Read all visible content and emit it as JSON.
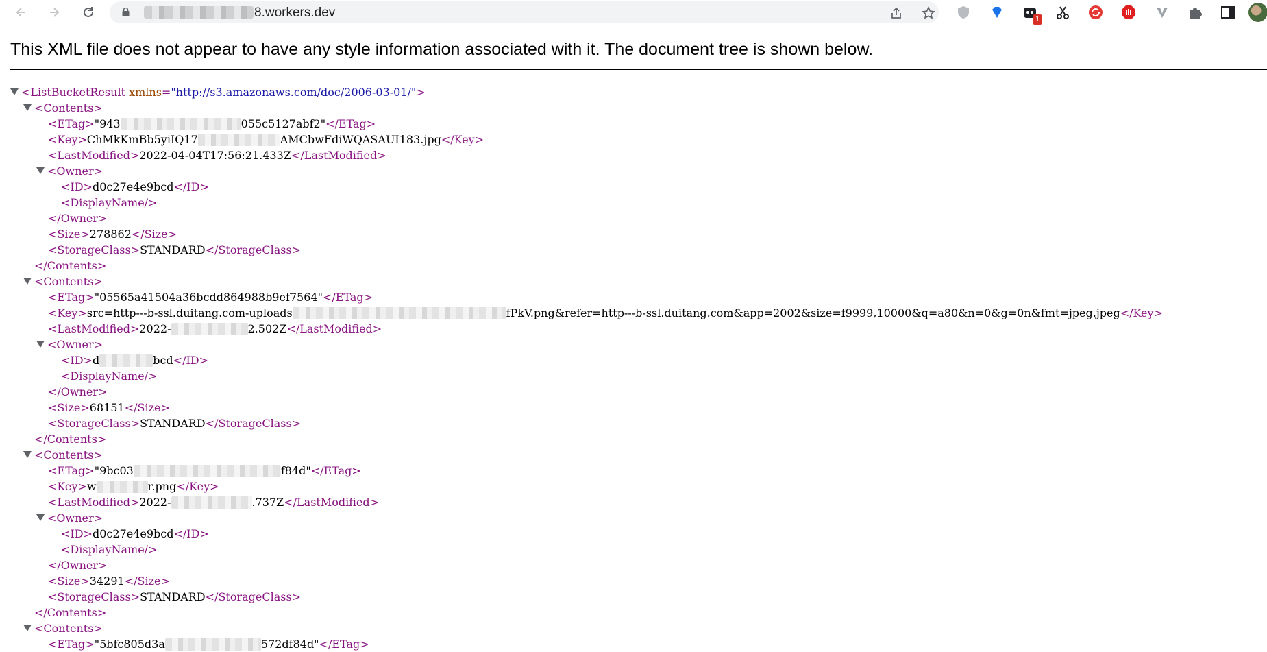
{
  "browser": {
    "url_visible_suffix": "8.workers.dev",
    "extension_badge": "1"
  },
  "page": {
    "notice": "This XML file does not appear to have any style information associated with it. The document tree is shown below."
  },
  "xml": {
    "root_open": "<ListBucketResult",
    "root_attr_name": "xmlns",
    "root_attr_value": "\"http://s3.amazonaws.com/doc/2006-03-01/\"",
    "contents_open": "<Contents>",
    "contents_close": "</Contents>",
    "owner_open": "<Owner>",
    "owner_close": "</Owner>",
    "display_name": "<DisplayName/>",
    "tags": {
      "etag_open": "<ETag>",
      "etag_close": "</ETag>",
      "key_open": "<Key>",
      "key_close": "</Key>",
      "lm_open": "<LastModified>",
      "lm_close": "</LastModified>",
      "id_open": "<ID>",
      "id_close": "</ID>",
      "size_open": "<Size>",
      "size_close": "</Size>",
      "sc_open": "<StorageClass>",
      "sc_close": "</StorageClass>"
    },
    "contents": [
      {
        "etag_start": "\"943",
        "etag_end": "055c5127abf2\"",
        "key_start": "ChMkKmBb5yiIQ17",
        "key_end": "AMCbwFdiWQASAUI183.jpg",
        "last_modified_start": "2022-04-04T17:56:21.433Z",
        "last_modified_end": "",
        "owner_id_start": "d0c27e4e9bcd",
        "owner_id_end": "",
        "size": "278862",
        "storage_class": "STANDARD"
      },
      {
        "etag_start": "\"05565a41504a36bcdd864988b9ef7564\"",
        "etag_end": "",
        "key_start": "src=http---b-ssl.duitang.com-uploads",
        "key_end": "fPkV.png&refer=http---b-ssl.duitang.com&app=2002&size=f9999,10000&q=a80&n=0&g=0n&fmt=jpeg.jpeg",
        "last_modified_start": "2022-",
        "last_modified_end": "2.502Z",
        "owner_id_start": "d",
        "owner_id_end": "bcd",
        "size": "68151",
        "storage_class": "STANDARD"
      },
      {
        "etag_start": "\"9bc03",
        "etag_end": "f84d\"",
        "key_start": "w",
        "key_end": "r.png",
        "last_modified_start": "2022-",
        "last_modified_end": ".737Z",
        "owner_id_start": "d0c27e4e9bcd",
        "owner_id_end": "",
        "size": "34291",
        "storage_class": "STANDARD"
      },
      {
        "etag_start": "\"5bfc805d3a",
        "etag_end": "572df84d\""
      }
    ]
  }
}
